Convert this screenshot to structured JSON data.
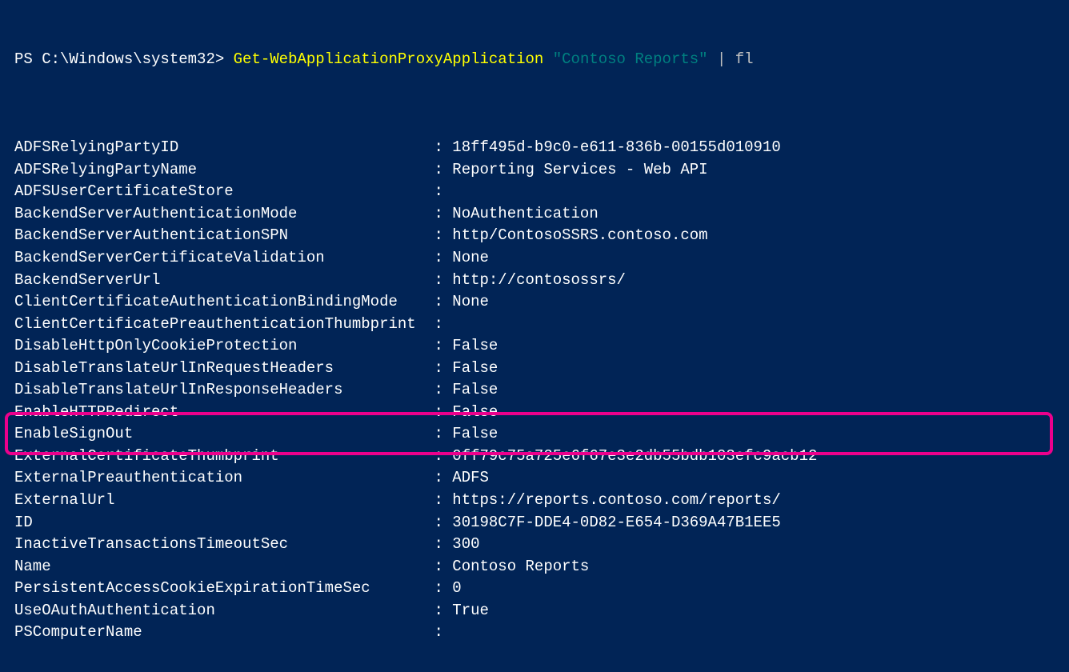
{
  "prompt": {
    "prefix": "PS C:\\Windows\\system32> ",
    "cmdlet": "Get-WebApplicationProxyApplication ",
    "argument": "\"Contoso Reports\"",
    "pipe": " | fl"
  },
  "rows": [
    {
      "key": "ADFSRelyingPartyID",
      "value": "18ff495d-b9c0-e611-836b-00155d010910"
    },
    {
      "key": "ADFSRelyingPartyName",
      "value": "Reporting Services - Web API"
    },
    {
      "key": "ADFSUserCertificateStore",
      "value": ""
    },
    {
      "key": "BackendServerAuthenticationMode",
      "value": "NoAuthentication"
    },
    {
      "key": "BackendServerAuthenticationSPN",
      "value": "http/ContosoSSRS.contoso.com"
    },
    {
      "key": "BackendServerCertificateValidation",
      "value": "None"
    },
    {
      "key": "BackendServerUrl",
      "value": "http://contosossrs/"
    },
    {
      "key": "ClientCertificateAuthenticationBindingMode",
      "value": "None"
    },
    {
      "key": "ClientCertificatePreauthenticationThumbprint",
      "value": ""
    },
    {
      "key": "DisableHttpOnlyCookieProtection",
      "value": "False"
    },
    {
      "key": "DisableTranslateUrlInRequestHeaders",
      "value": "False"
    },
    {
      "key": "DisableTranslateUrlInResponseHeaders",
      "value": "False"
    },
    {
      "key": "EnableHTTPRedirect",
      "value": "False"
    },
    {
      "key": "EnableSignOut",
      "value": "False"
    },
    {
      "key": "ExternalCertificateThumbprint",
      "value": "0ff79c75a725e6f67e3e2db55bdb103efc9acb12"
    },
    {
      "key": "ExternalPreauthentication",
      "value": "ADFS"
    },
    {
      "key": "ExternalUrl",
      "value": "https://reports.contoso.com/reports/"
    },
    {
      "key": "ID",
      "value": "30198C7F-DDE4-0D82-E654-D369A47B1EE5"
    },
    {
      "key": "InactiveTransactionsTimeoutSec",
      "value": "300"
    },
    {
      "key": "Name",
      "value": "Contoso Reports"
    },
    {
      "key": "PersistentAccessCookieExpirationTimeSec",
      "value": "0"
    },
    {
      "key": "UseOAuthAuthentication",
      "value": "True"
    },
    {
      "key": "PSComputerName",
      "value": ""
    }
  ],
  "highlightIndex": 17
}
